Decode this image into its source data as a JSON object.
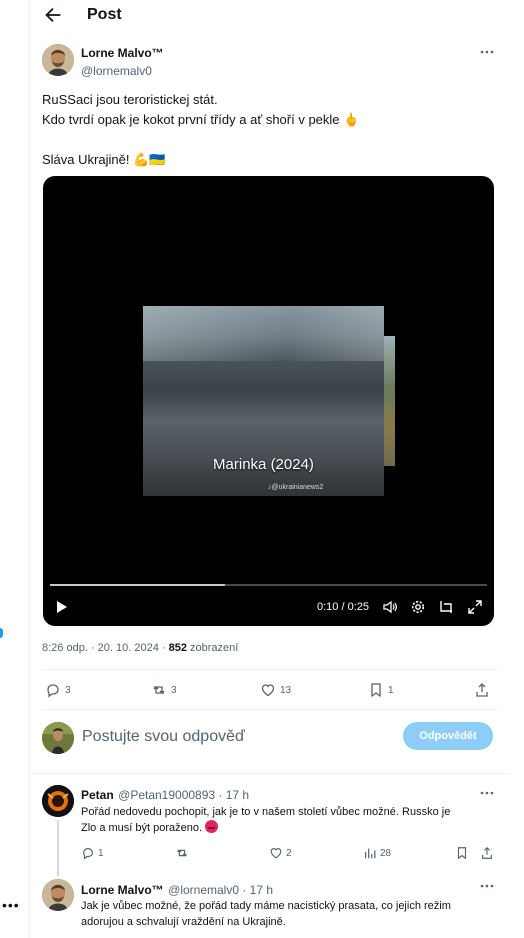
{
  "header": {
    "title": "Post"
  },
  "post": {
    "author_name": "Lorne Malvo™",
    "author_handle": "@lornemalv0",
    "lines": [
      "RuSSaci jsou teroristickej stát.",
      "Kdo tvrdí opak je kokot první třídy a ať shoří v pekle 🖕",
      "",
      "Sláva Ukrajině! 💪🇺🇦"
    ],
    "video": {
      "caption": "Marinka (2024)",
      "watermark": "♪@ukrainianews2",
      "time_display": "0:10 / 0:25",
      "progress_fraction": 0.4
    },
    "timestamp": "8:26 odp. · 20. 10. 2024 · ",
    "views_count": "852",
    "views_label": " zobrazení",
    "actions": {
      "replies": "3",
      "reposts": "3",
      "likes": "13",
      "bookmarks": "1"
    }
  },
  "compose": {
    "placeholder": "Postujte svou odpověď",
    "button_label": "Odpovědět"
  },
  "replies": [
    {
      "author_name": "Petan",
      "author_handle": "@Petan19000893 · 17 h",
      "text_line1": "Pořád nedovedu pochopit, jak je to v našem století vůbec možné. Russko je",
      "text_line2": "Zlo a musí být poraženo. ",
      "counts": {
        "replies": "1",
        "likes": "2",
        "views": "28"
      }
    },
    {
      "author_name": "Lorne Malvo™",
      "author_handle": "@lornemalv0 · 17 h",
      "text_line1": "Jak je vůbec možné, že pořád tady máme nacistický prasata, co jejich režim",
      "text_line2": "adorujou a schvalují vraždění na Ukrajině."
    }
  ],
  "left_rail": {
    "more": "•••"
  },
  "colors": {
    "accent": "#1d9bf0",
    "reply_button_disabled": "#8ecdf7",
    "secondary_text": "#536471"
  }
}
